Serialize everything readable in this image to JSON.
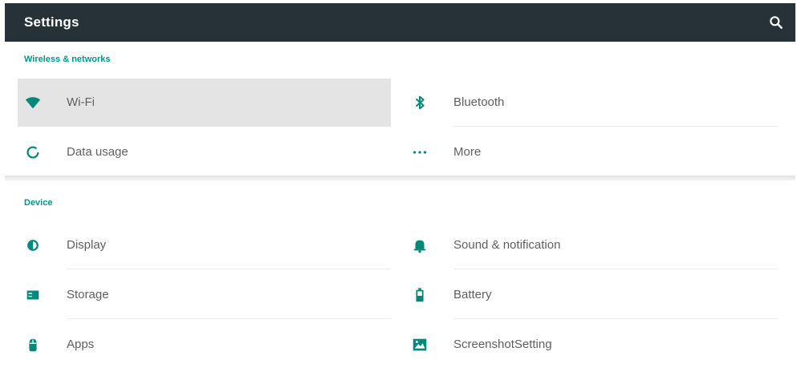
{
  "toolbar": {
    "title": "Settings",
    "search_icon": "search-icon"
  },
  "colors": {
    "toolbar_bg": "#263238",
    "accent": "#009688",
    "selected_bg": "#e4e4e4",
    "text": "#5f5f5f"
  },
  "sections": [
    {
      "header": "Wireless & networks",
      "items": [
        {
          "label": "Wi-Fi",
          "icon": "wifi-icon",
          "selected": true
        },
        {
          "label": "Bluetooth",
          "icon": "bluetooth-icon"
        },
        {
          "label": "Data usage",
          "icon": "data-usage-icon"
        },
        {
          "label": "More",
          "icon": "more-icon"
        }
      ]
    },
    {
      "header": "Device",
      "items": [
        {
          "label": "Display",
          "icon": "display-icon"
        },
        {
          "label": "Sound & notification",
          "icon": "bell-icon"
        },
        {
          "label": "Storage",
          "icon": "storage-icon"
        },
        {
          "label": "Battery",
          "icon": "battery-icon"
        },
        {
          "label": "Apps",
          "icon": "apps-icon"
        },
        {
          "label": "ScreenshotSetting",
          "icon": "screenshot-icon"
        }
      ]
    }
  ]
}
